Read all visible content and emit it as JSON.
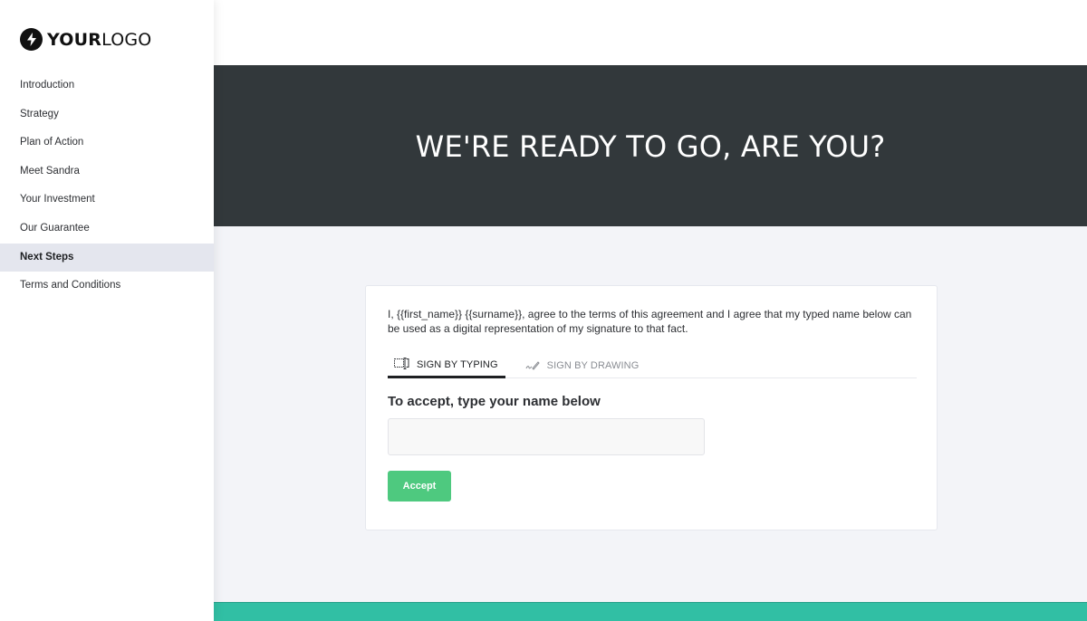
{
  "logo": {
    "icon": "lightning-bolt-icon",
    "text_bold": "YOUR",
    "text_light": "LOGO"
  },
  "sidebar": {
    "items": [
      {
        "label": "Introduction",
        "active": false
      },
      {
        "label": "Strategy",
        "active": false
      },
      {
        "label": "Plan of Action",
        "active": false
      },
      {
        "label": "Meet Sandra",
        "active": false
      },
      {
        "label": "Your Investment",
        "active": false
      },
      {
        "label": "Our Guarantee",
        "active": false
      },
      {
        "label": "Next Steps",
        "active": true
      },
      {
        "label": "Terms and Conditions",
        "active": false
      }
    ]
  },
  "hero": {
    "title": "WE'RE READY TO GO, ARE YOU?"
  },
  "signature": {
    "agreement_text": "I, {{first_name}} {{surname}}, agree to the terms of this agreement and I agree that my typed name below can be used as a digital representation of my signature to that fact.",
    "tabs": [
      {
        "label": "SIGN BY TYPING",
        "icon": "text-cursor-icon",
        "active": true
      },
      {
        "label": "SIGN BY DRAWING",
        "icon": "pen-signature-icon",
        "active": false
      }
    ],
    "heading": "To accept, type your name below",
    "name_input": {
      "value": "",
      "placeholder": ""
    },
    "accept_label": "Accept"
  },
  "colors": {
    "hero_bg": "#32383b",
    "accent_green": "#4ec97f",
    "footer_teal": "#31bfa4",
    "active_nav_bg": "#e4e6ee"
  }
}
